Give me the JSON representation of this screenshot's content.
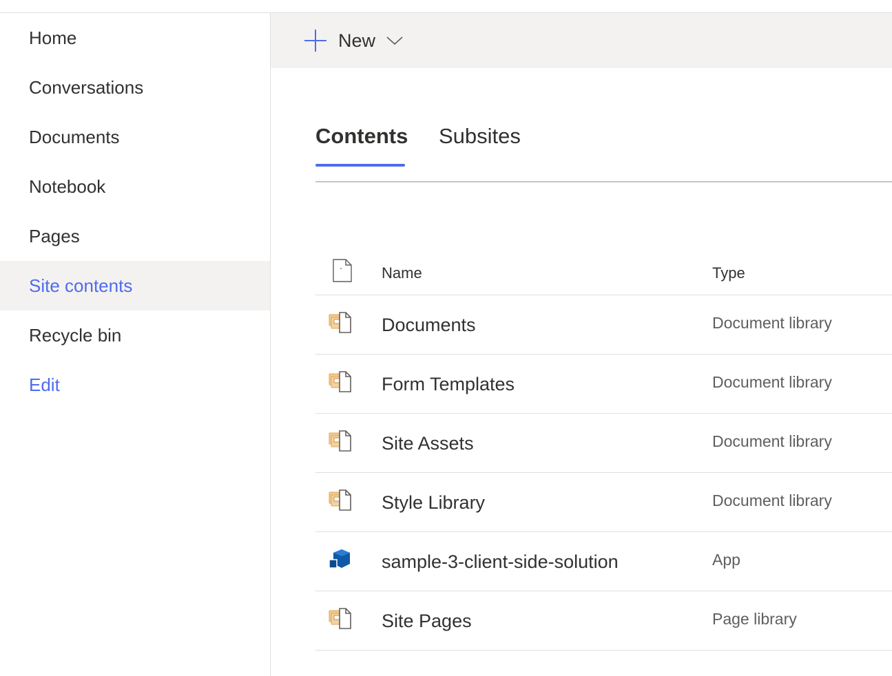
{
  "nav": {
    "items": [
      {
        "label": "Home",
        "selected": false
      },
      {
        "label": "Conversations",
        "selected": false
      },
      {
        "label": "Documents",
        "selected": false
      },
      {
        "label": "Notebook",
        "selected": false
      },
      {
        "label": "Pages",
        "selected": false
      },
      {
        "label": "Site contents",
        "selected": true
      },
      {
        "label": "Recycle bin",
        "selected": false
      }
    ],
    "edit_label": "Edit"
  },
  "commandbar": {
    "new_label": "New",
    "new_icon": "plus-icon",
    "dropdown_icon": "chevron-down-icon"
  },
  "tabs": [
    {
      "label": "Contents",
      "active": true
    },
    {
      "label": "Subsites",
      "active": false
    }
  ],
  "list": {
    "headers": {
      "name": "Name",
      "type": "Type",
      "icon": "file-icon"
    },
    "rows": [
      {
        "name": "Documents",
        "type": "Document library",
        "icon": "document-library-icon"
      },
      {
        "name": "Form Templates",
        "type": "Document library",
        "icon": "document-library-icon"
      },
      {
        "name": "Site Assets",
        "type": "Document library",
        "icon": "document-library-icon"
      },
      {
        "name": "Style Library",
        "type": "Document library",
        "icon": "document-library-icon"
      },
      {
        "name": "sample-3-client-side-solution",
        "type": "App",
        "icon": "app-icon"
      },
      {
        "name": "Site Pages",
        "type": "Page library",
        "icon": "document-library-icon"
      }
    ]
  },
  "colors": {
    "accent": "#4f6bed",
    "commandbar_bg": "#f3f2f1",
    "selected_bg": "#f3f2f1",
    "library_icon": "#e8b26b",
    "app_icon": "#0f5aa6"
  }
}
